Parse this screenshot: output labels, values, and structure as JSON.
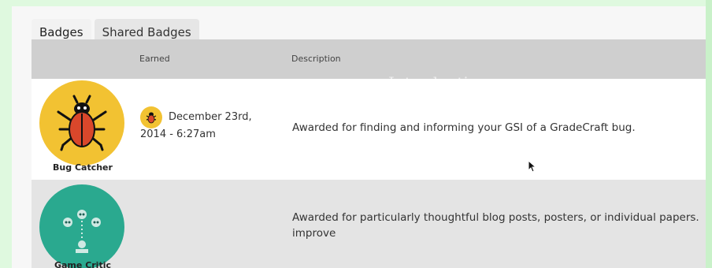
{
  "tabs": [
    {
      "label": "Badges",
      "active": true
    },
    {
      "label": "Shared Badges",
      "active": false
    }
  ],
  "columns": {
    "earned": "Earned",
    "description": "Description"
  },
  "rows": [
    {
      "badge_name": "Bug Catcher",
      "badge_icon": "bug-icon",
      "earned_icon": "bug-icon",
      "earned_line1": "December 23rd,",
      "earned_line2": "2014 - 6:27am",
      "description": "Awarded for finding and informing your GSI of a GradeCraft bug."
    },
    {
      "badge_name": "Game Critic",
      "badge_icon": "critic-figures-icon",
      "description": "Awarded for particularly thoughtful blog posts, posters, or individual papers. improve"
    }
  ],
  "background_text": "Introductions",
  "colors": {
    "mint": "#dff9df",
    "bug_badge": "#f2c232",
    "critic_badge": "#2aa98f",
    "bug_red": "#d9472b",
    "header_gray": "#cfcfcf"
  }
}
